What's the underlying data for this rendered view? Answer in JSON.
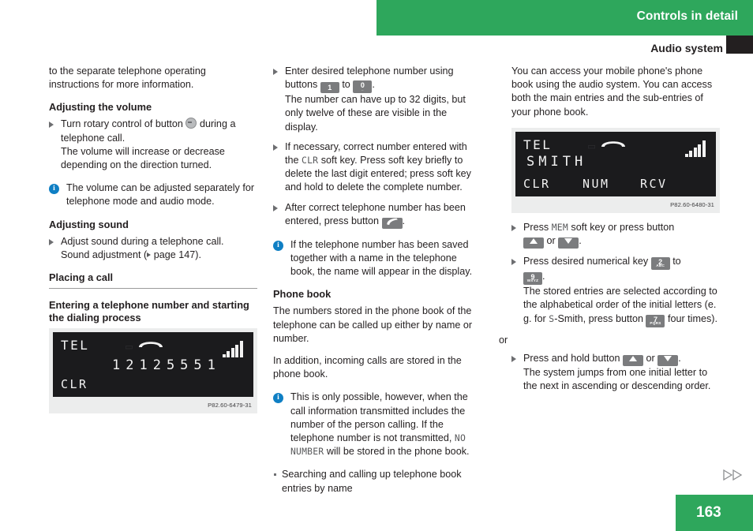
{
  "header": {
    "chapter_title": "Controls in detail",
    "section_title": "Audio system",
    "green": "#2ea75c"
  },
  "footer": {
    "page_number": "163"
  },
  "column_left": {
    "intro": "to the separate telephone operating instructions for more information.",
    "head_volume": "Adjusting the volume",
    "step_volume_a": "Turn rotary control of button",
    "step_volume_b": "during a telephone call.",
    "step_volume_c": "The volume will increase or decrease depending on the direction turned.",
    "note_volume": "The volume can be adjusted separately for telephone mode and audio mode.",
    "head_sound": "Adjusting sound",
    "step_sound_a": "Adjust sound during a telephone call.",
    "step_sound_b_pre": "Sound adjustment (",
    "step_sound_b_post": "page 147).",
    "head_placing": "Placing a call",
    "head_entering": "Entering a telephone number and starting the dialing process",
    "figure": {
      "mode": "TEL",
      "number": "12125551",
      "softkey_left": "CLR",
      "caption": "P82.60-6479-31",
      "signal_bars": 5
    }
  },
  "column_middle": {
    "step_enter_a": "Enter desired telephone number using buttons",
    "key_1": "1",
    "step_enter_to": "to",
    "key_0": "0",
    "step_enter_dot": ".",
    "step_enter_b": "The number can have up to 32 digits, but only twelve of these are visible in the display.",
    "step_correct_a": "If necessary, correct number entered with the",
    "key_clr": "CLR",
    "step_correct_b": "soft key. Press soft key briefly to delete the last digit entered; press soft key and hold to delete the complete number.",
    "step_press_a": "After correct telephone number has been entered, press button",
    "step_press_dot": ".",
    "note_saved": "If the telephone number has been saved together with a name in the telephone book, the name will appear in the display.",
    "head_phone_book": "Phone book",
    "para_1": "The numbers stored in the phone book of the telephone can be called up either by name or number.",
    "para_2": "In addition, incoming calls are stored in the phone book.",
    "note_a": "This is only possible, however, when the call information transmitted includes the number of the person calling. If the telephone number is not transmitted,",
    "note_no_number": "NO NUMBER",
    "note_b": "will be stored in the phone book.",
    "bullet_search": "Searching and calling up telephone book entries by name"
  },
  "column_right": {
    "para_1": "You can access your mobile phone's phone book using the audio system. You can access both the main entries and the sub-entries of your phone book.",
    "figure": {
      "mode": "TEL",
      "name": "SMITH",
      "softkey_left": "CLR",
      "softkey_mid": "NUM",
      "softkey_right": "RCV",
      "caption": "P82.60-6480-31",
      "signal_bars": 5
    },
    "step_mem_a": "Press",
    "key_mem": "MEM",
    "step_mem_b": "soft key or press button",
    "step_mem_or": "or",
    "step_mem_dot": ".",
    "step_numeric_a": "Press desired numerical key",
    "key_2_num": "2",
    "key_2_sub": "ABC",
    "step_numeric_to": "to",
    "key_9_num": "9",
    "key_9_sub": "WXYZ",
    "step_numeric_dot": ".",
    "step_numeric_b_pre": "The stored entries are selected according to the alphabetical order of the initial letters (e. g. for",
    "letter_s": "S",
    "step_numeric_b_mid": "-Smith, press button",
    "key_7_num": "7",
    "key_7_sub": "PQRS",
    "step_numeric_b_post": "four times).",
    "or_word": "or",
    "step_hold_a": "Press and hold button",
    "step_hold_or": "or",
    "step_hold_dot": ".",
    "step_hold_b": "The system jumps from one initial letter to the next in ascending or descending order."
  }
}
